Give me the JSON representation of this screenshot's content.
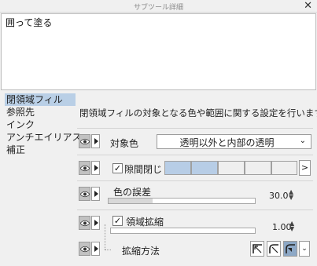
{
  "window": {
    "title": "サブツール詳細",
    "close_label": "✕"
  },
  "preview": {
    "text": "囲って塗る"
  },
  "categories": [
    {
      "label": "閉領域フィル",
      "active": true
    },
    {
      "label": "参照先",
      "active": false
    },
    {
      "label": "インク",
      "active": false
    },
    {
      "label": "アンチエイリアス",
      "active": false
    },
    {
      "label": "補正",
      "active": false
    }
  ],
  "description": "閉領域フィルの対象となる色や範囲に関する設定を行います。",
  "settings": {
    "target_color": {
      "label": "対象色",
      "value": "透明以外と内部の透明",
      "chevron": "⌄"
    },
    "close_gap": {
      "label": "隙間閉じ",
      "checked": true,
      "check_mark": "✓",
      "level": 2,
      "steps": 5,
      "arrow": ">"
    },
    "color_margin": {
      "label": "色の誤差",
      "value": "30.0",
      "fraction": 0.3
    },
    "area_scaling": {
      "label": "領域拡縮",
      "checked": true,
      "check_mark": "✓",
      "value": "1.00",
      "fraction": 0.0
    },
    "scaling_method": {
      "label": "拡縮方法",
      "selected_index": 2,
      "options": [
        "square-corner-icon",
        "rounded-corner-icon",
        "darkest-pixel-icon"
      ],
      "chevron": "⌄"
    }
  },
  "spin_up": "▲",
  "spin_down": "▼"
}
